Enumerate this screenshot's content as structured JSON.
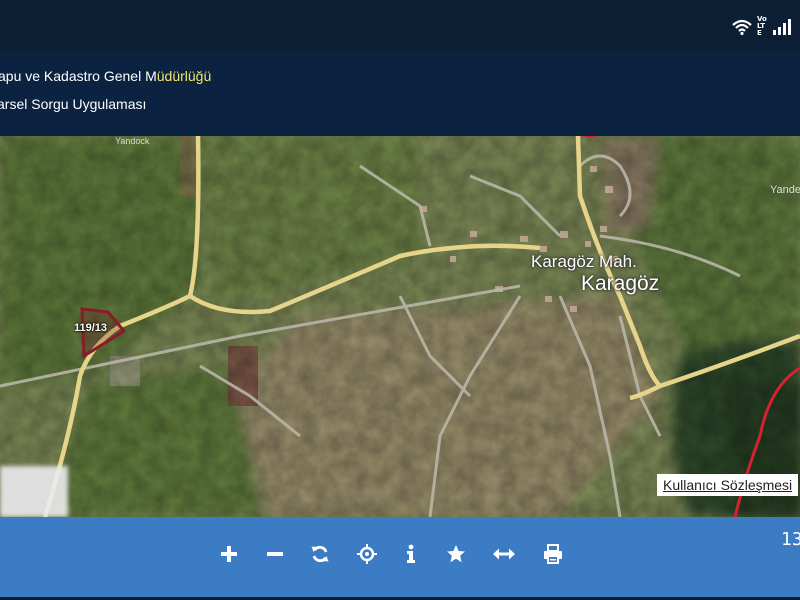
{
  "statusbar": {
    "icons": [
      "wifi-icon",
      "volte-icon",
      "signal-icon",
      "battery-icon"
    ],
    "volte_label": "Vo LTE"
  },
  "header": {
    "title_line1_prefix": "apu ve Kadastro Genel M",
    "title_line1_highlight": "üdürlüğü",
    "title_line2": "arsel Sorgu Uygulaması"
  },
  "map": {
    "parcel_label": "119/13",
    "place_mahalle": "Karagöz Mah.",
    "place_village": "Karagöz",
    "place_faded_right": "Yande",
    "place_faded_top": "Yandock",
    "terms_link": "Kullanıcı Sözleşmesi",
    "colors": {
      "parcel_outline": "#8b1a2b",
      "boundary_line": "#d4232f",
      "road": "#e8d58a",
      "track": "#b8b8b8"
    }
  },
  "toolbar": {
    "buttons": [
      {
        "name": "zoom-in-button",
        "icon": "plus-icon"
      },
      {
        "name": "zoom-out-button",
        "icon": "minus-icon"
      },
      {
        "name": "refresh-button",
        "icon": "refresh-icon"
      },
      {
        "name": "locate-button",
        "icon": "crosshair-icon"
      },
      {
        "name": "info-button",
        "icon": "info-icon"
      },
      {
        "name": "favorite-button",
        "icon": "star-icon"
      },
      {
        "name": "measure-button",
        "icon": "arrows-horizontal-icon"
      },
      {
        "name": "print-button",
        "icon": "printer-icon"
      }
    ],
    "scale_text": "13",
    "background": "#3b7cc4"
  }
}
